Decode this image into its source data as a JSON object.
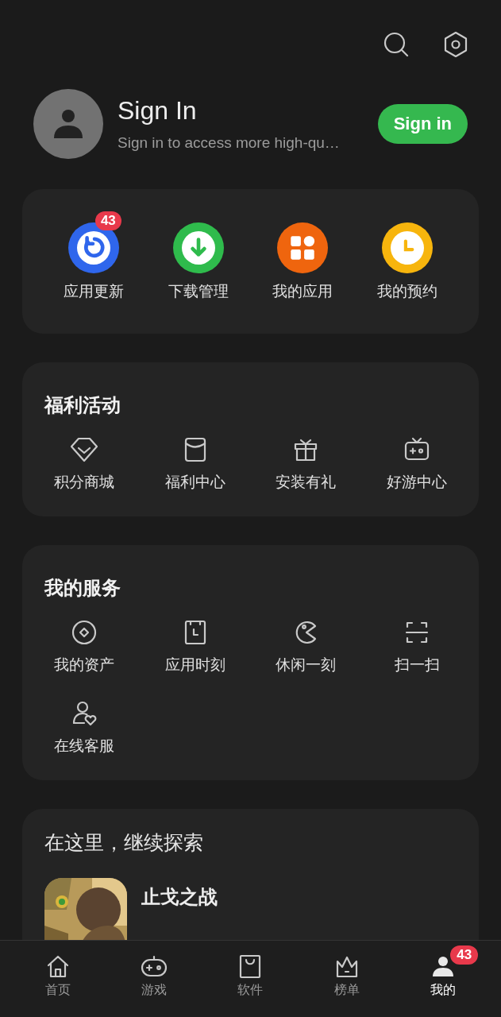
{
  "profile": {
    "title": "Sign In",
    "subtitle": "Sign in to access more high-qu…",
    "button": "Sign in"
  },
  "shortcuts": [
    {
      "label": "应用更新",
      "color": "#2f66ec",
      "badge": "43"
    },
    {
      "label": "下载管理",
      "color": "#2fbb4c"
    },
    {
      "label": "我的应用",
      "color": "#ef650e"
    },
    {
      "label": "我的预约",
      "color": "#f7b50d"
    }
  ],
  "welfare": {
    "title": "福利活动",
    "items": [
      {
        "label": "积分商城"
      },
      {
        "label": "福利中心"
      },
      {
        "label": "安装有礼"
      },
      {
        "label": "好游中心"
      }
    ]
  },
  "services": {
    "title": "我的服务",
    "items": [
      {
        "label": "我的资产"
      },
      {
        "label": "应用时刻"
      },
      {
        "label": "休闲一刻"
      },
      {
        "label": "扫一扫"
      },
      {
        "label": "在线客服"
      }
    ]
  },
  "explore": {
    "title": "在这里，继续探索",
    "apps": [
      {
        "name": "止戈之战",
        "kind": "picture"
      }
    ]
  },
  "nav": [
    {
      "label": "首页",
      "selected": false
    },
    {
      "label": "游戏",
      "selected": false
    },
    {
      "label": "软件",
      "selected": false
    },
    {
      "label": "榜单",
      "selected": false
    },
    {
      "label": "我的",
      "selected": true,
      "badge": "43"
    }
  ]
}
